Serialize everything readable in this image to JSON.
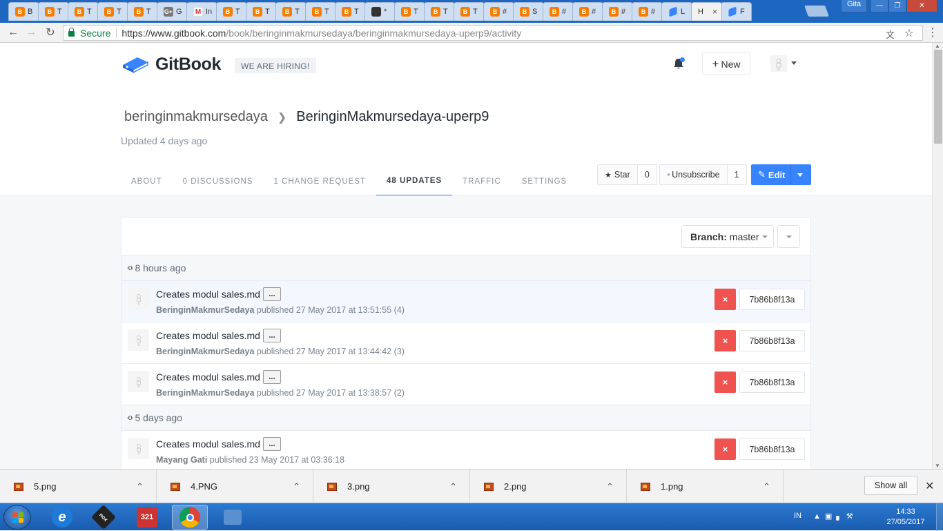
{
  "browser": {
    "tabs": [
      {
        "label": "B",
        "icon": "blogger"
      },
      {
        "label": "T",
        "icon": "blogger"
      },
      {
        "label": "T",
        "icon": "blogger"
      },
      {
        "label": "T",
        "icon": "blogger"
      },
      {
        "label": "T",
        "icon": "blogger"
      },
      {
        "label": "G",
        "icon": "gplus"
      },
      {
        "label": "In",
        "icon": "gmail"
      },
      {
        "label": "T",
        "icon": "blogger"
      },
      {
        "label": "T",
        "icon": "blogger"
      },
      {
        "label": "T",
        "icon": "blogger"
      },
      {
        "label": "T",
        "icon": "blogger"
      },
      {
        "label": "T",
        "icon": "blogger"
      },
      {
        "label": "*",
        "icon": "dark"
      },
      {
        "label": "T",
        "icon": "blogger"
      },
      {
        "label": "T",
        "icon": "blogger"
      },
      {
        "label": "T",
        "icon": "blogger"
      },
      {
        "label": "#",
        "icon": "blogger"
      },
      {
        "label": "S",
        "icon": "blogger"
      },
      {
        "label": "#",
        "icon": "blogger"
      },
      {
        "label": "#",
        "icon": "blogger"
      },
      {
        "label": "#",
        "icon": "blogger"
      },
      {
        "label": "#",
        "icon": "blogger"
      },
      {
        "label": "L",
        "icon": "gitbook"
      },
      {
        "label": "H",
        "icon": "none",
        "active": true
      },
      {
        "label": "F",
        "icon": "gitbook"
      }
    ],
    "user": "Gita",
    "secure_label": "Secure",
    "url_host": "https://www.gitbook.com",
    "url_path": "/book/beringinmakmursedaya/beringinmakmursedaya-uperp9/activity"
  },
  "header": {
    "brand": "GitBook",
    "hiring": "WE ARE HIRING!",
    "new_label": "New"
  },
  "book": {
    "owner": "beringinmakmursedaya",
    "title": "BeringinMakmursedaya-uperp9",
    "updated": "Updated 4 days ago"
  },
  "tabs": [
    {
      "label": "ABOUT"
    },
    {
      "label": "0 DISCUSSIONS"
    },
    {
      "label": "1 CHANGE REQUEST"
    },
    {
      "label": "48 UPDATES",
      "active": true
    },
    {
      "label": "TRAFFIC"
    },
    {
      "label": "SETTINGS"
    }
  ],
  "actions": {
    "star_label": "Star",
    "star_count": "0",
    "unsubscribe_label": "Unsubscribe",
    "unsubscribe_count": "1",
    "edit_label": "Edit"
  },
  "branch": {
    "label": "Branch:",
    "value": "master"
  },
  "activity": [
    {
      "group": "8 hours ago",
      "items": [
        {
          "title": "Creates modul sales.md",
          "dots": "...",
          "author": "BeringinMakmurSedaya",
          "meta": " published 27 May 2017 at 13:51:55 (4)",
          "revert": "×",
          "sha": "7b86b8f13a",
          "highlight": true
        },
        {
          "title": "Creates modul sales.md",
          "dots": "...",
          "author": "BeringinMakmurSedaya",
          "meta": " published 27 May 2017 at 13:44:42 (3)",
          "revert": "×",
          "sha": "7b86b8f13a"
        },
        {
          "title": "Creates modul sales.md",
          "dots": "...",
          "author": "BeringinMakmurSedaya",
          "meta": " published 27 May 2017 at 13:38:57 (2)",
          "revert": "×",
          "sha": "7b86b8f13a"
        }
      ]
    },
    {
      "group": "5 days ago",
      "items": [
        {
          "title": "Creates modul sales.md",
          "dots": "...",
          "author": "Mayang Gati",
          "meta": " published 23 May 2017 at 03:36:18",
          "revert": "×",
          "sha": "7b86b8f13a"
        }
      ]
    }
  ],
  "downloads": {
    "files": [
      "5.png",
      "4.PNG",
      "3.png",
      "2.png",
      "1.png"
    ],
    "show_all": "Show all"
  },
  "taskbar": {
    "apps": [
      {
        "name": "internet-explorer",
        "label": "e",
        "color": "#1f7ad6"
      },
      {
        "name": "nox",
        "label": "nox",
        "color": "#222"
      },
      {
        "name": "media-player",
        "label": "321",
        "color": "#c33"
      },
      {
        "name": "chrome",
        "label": "",
        "color": "#fff",
        "active": true
      },
      {
        "name": "control-panel",
        "label": "",
        "color": "#5a8fd0"
      }
    ],
    "lang": "IN",
    "time": "14:33",
    "date": "27/05/2017"
  },
  "colors": {
    "accent": "#3884ff",
    "danger": "#ef5350",
    "blogger": "#f57d00"
  }
}
